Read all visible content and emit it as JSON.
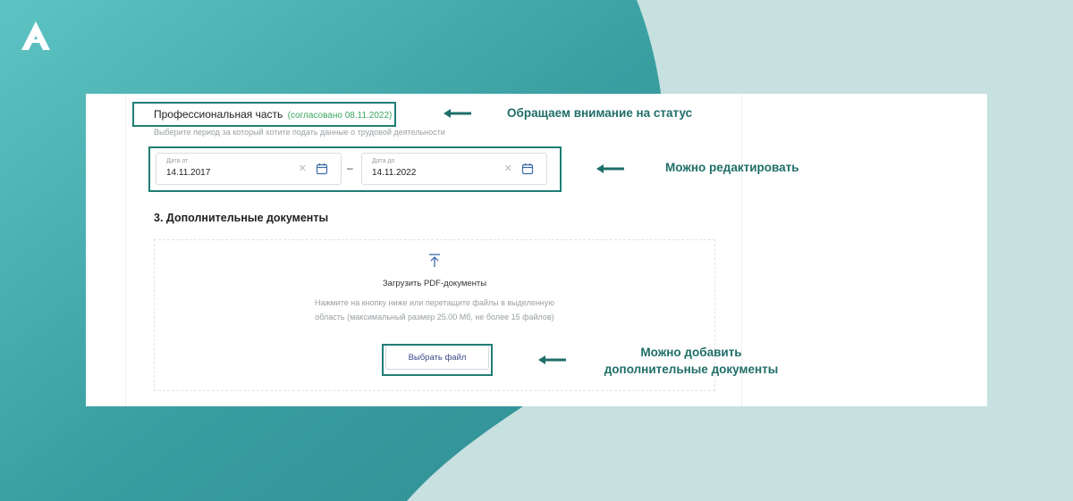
{
  "colors": {
    "background_light": "#c7e0e0",
    "background_teal": "#3fa3a4",
    "highlight_border": "#1f7e74",
    "callout_text": "#1f6e69",
    "status_green": "#3aa860"
  },
  "logo": {
    "icon": "a-letter-logo"
  },
  "form": {
    "section_title": "Профессиональная часть",
    "section_status": "(согласовано 08.11.2022)",
    "period_hint": "Выберите период за который хотите подать данные о трудовой деятельности",
    "date_from": {
      "label": "Дата от",
      "value": "14.11.2017",
      "clear_icon": "close-icon",
      "calendar_icon": "calendar-icon"
    },
    "date_to": {
      "label": "Дата до",
      "value": "14.11.2022",
      "clear_icon": "close-icon",
      "calendar_icon": "calendar-icon"
    },
    "range_separator": "–",
    "documents_heading": "3. Дополнительные документы",
    "upload": {
      "icon": "upload-icon",
      "title": "Загрузить PDF-документы",
      "description": "Нажмите на кнопку ниже или перетащите файлы в выделенную область (максимальный размер 25.00 Мб, не более 15 файлов)",
      "button_label": "Выбрать файл"
    }
  },
  "callouts": {
    "status": "Обращаем внимание на статус",
    "editable": "Можно редактировать",
    "add_docs_line1": "Можно добавить",
    "add_docs_line2": "дополнительные документы"
  }
}
